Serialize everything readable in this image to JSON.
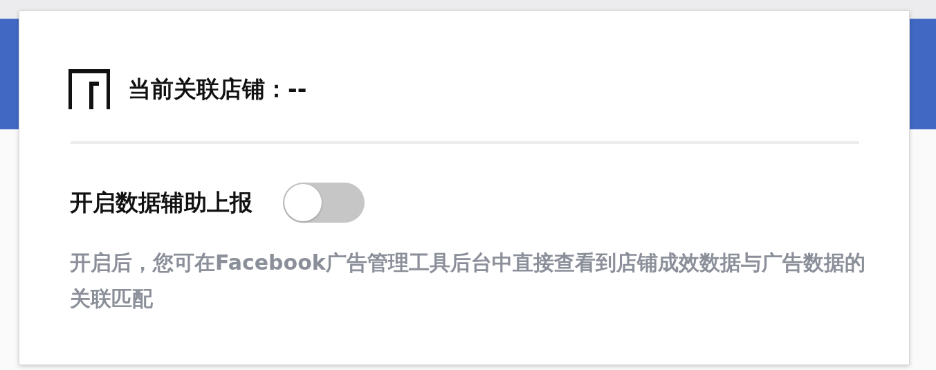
{
  "popup": {
    "store_label": "当前关联店铺：--",
    "toggle": {
      "label": "开启数据辅助上报",
      "on": false
    },
    "description": "开启后，您可在Facebook广告管理工具后台中直接查看到店铺成效数据与广告数据的关联匹配"
  }
}
